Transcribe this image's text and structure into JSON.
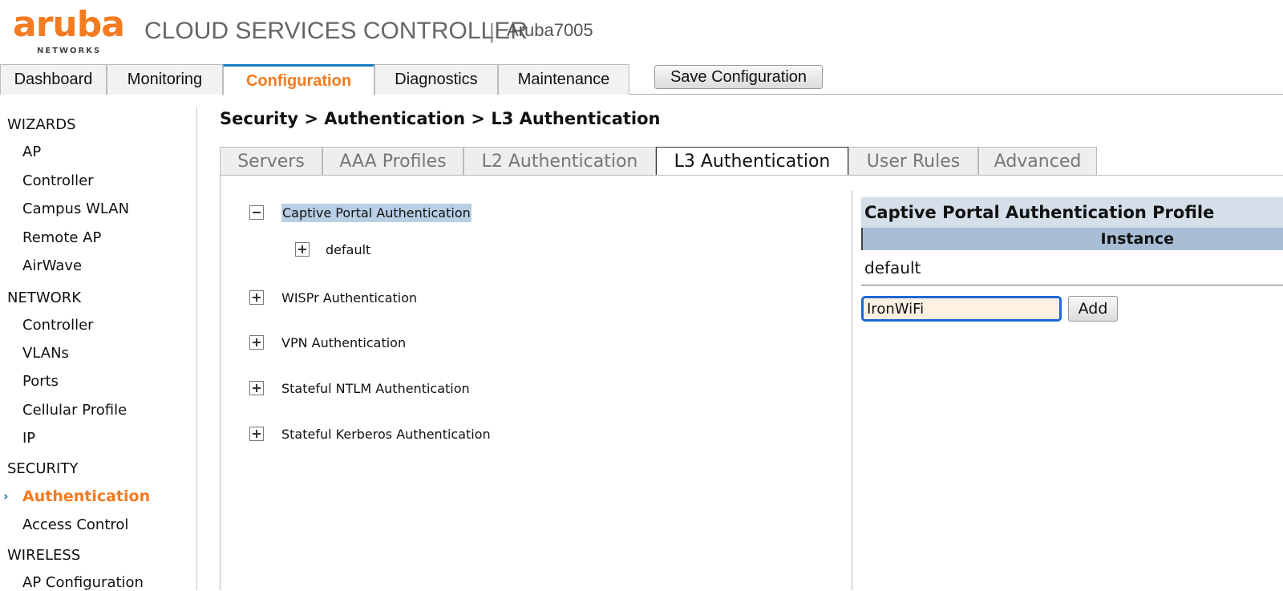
{
  "brand": {
    "logo_word": "aruba",
    "logo_sub": "NETWORKS",
    "product": "CLOUD SERVICES CONTROLLER",
    "separator": "|",
    "hostname": "Aruba7005",
    "accent": "#f37b21",
    "link_blue": "#1d7cc0"
  },
  "topnav": {
    "tabs": [
      {
        "label": "Dashboard"
      },
      {
        "label": "Monitoring"
      },
      {
        "label": "Configuration"
      },
      {
        "label": "Diagnostics"
      },
      {
        "label": "Maintenance"
      }
    ],
    "active": "Configuration",
    "save_label": "Save Configuration"
  },
  "sidebar": {
    "sections": [
      {
        "title": "WIZARDS",
        "items": [
          "AP",
          "Controller",
          "Campus WLAN",
          "Remote AP",
          "AirWave"
        ]
      },
      {
        "title": "NETWORK",
        "items": [
          "Controller",
          "VLANs",
          "Ports",
          "Cellular Profile",
          "IP"
        ]
      },
      {
        "title": "SECURITY",
        "items": [
          "Authentication",
          "Access Control"
        ]
      },
      {
        "title": "WIRELESS",
        "items": [
          "AP Configuration"
        ]
      }
    ],
    "active_item": "Authentication"
  },
  "main": {
    "breadcrumb": "Security > Authentication > L3 Authentication",
    "subtabs": [
      "Servers",
      "AAA Profiles",
      "L2 Authentication",
      "L3 Authentication",
      "User Rules",
      "Advanced"
    ],
    "active_subtab": "L3 Authentication",
    "tree": [
      {
        "label": "Captive Portal Authentication",
        "expanded": true,
        "selected": true,
        "children": [
          "default"
        ]
      },
      {
        "label": "WISPr Authentication",
        "expanded": false
      },
      {
        "label": "VPN Authentication",
        "expanded": false
      },
      {
        "label": "Stateful NTLM Authentication",
        "expanded": false
      },
      {
        "label": "Stateful Kerberos Authentication",
        "expanded": false
      }
    ]
  },
  "profile": {
    "title": "Captive Portal Authentication Profile",
    "column": "Instance",
    "rows": [
      "default"
    ],
    "new_instance_value": "IronWiFi",
    "add_label": "Add"
  }
}
